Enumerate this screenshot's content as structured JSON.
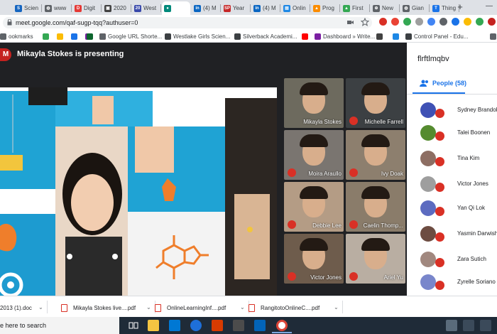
{
  "browser": {
    "tabs": [
      {
        "label": "Scien",
        "fav_color": "#1565c0",
        "fav_glyph": "S"
      },
      {
        "label": "www",
        "fav_color": "#5f6368",
        "fav_glyph": "◍"
      },
      {
        "label": "Digit",
        "fav_color": "#e53935",
        "fav_glyph": "D"
      },
      {
        "label": "2020",
        "fav_color": "#424242",
        "fav_glyph": "▣"
      },
      {
        "label": "West",
        "fav_color": "#3949ab",
        "fav_glyph": "20"
      },
      {
        "label": "",
        "fav_color": "#00897b",
        "fav_glyph": "●",
        "active": true
      },
      {
        "label": "(4) M",
        "fav_color": "#0a66c2",
        "fav_glyph": "in"
      },
      {
        "label": "Year",
        "fav_color": "#c62828",
        "fav_glyph": "SP"
      },
      {
        "label": "(4) M",
        "fav_color": "#0a66c2",
        "fav_glyph": "in"
      },
      {
        "label": "Onlin",
        "fav_color": "#1e88e5",
        "fav_glyph": "▤"
      },
      {
        "label": "Prog",
        "fav_color": "#fb8c00",
        "fav_glyph": "▲"
      },
      {
        "label": "First",
        "fav_color": "#34a853",
        "fav_glyph": "▲"
      },
      {
        "label": "New",
        "fav_color": "#5f6368",
        "fav_glyph": "⊕"
      },
      {
        "label": "Gian",
        "fav_color": "#5f6368",
        "fav_glyph": "◍"
      },
      {
        "label": "Thing",
        "fav_color": "#1a73e8",
        "fav_glyph": "T"
      }
    ],
    "new_tab_label": "+",
    "minimize_label": "—",
    "url": "meet.google.com/qaf-sugp-tqq?authuser=0",
    "bookmarks": [
      {
        "label": "ookmarks",
        "color": "#5f6368"
      },
      {
        "label": "",
        "color": "#34a853"
      },
      {
        "label": "",
        "color": "#fbbc04"
      },
      {
        "label": "",
        "color": "#1a73e8"
      },
      {
        "label": "",
        "color": "#7b1fa2"
      },
      {
        "label": "",
        "color": "#e53935"
      },
      {
        "label": "",
        "color": "#0d652d"
      },
      {
        "label": "Google URL Shorte...",
        "color": "#5f6368"
      },
      {
        "label": "Westlake Girls Scien...",
        "color": "#3c4043"
      },
      {
        "label": "Silverback Academi...",
        "color": "#3c4043"
      },
      {
        "label": "",
        "color": "#ff0000"
      },
      {
        "label": "Dashboard » Write...",
        "color": "#7b1fa2"
      },
      {
        "label": "",
        "color": "#424242"
      },
      {
        "label": "",
        "color": "#1e88e5"
      },
      {
        "label": "Control Panel - Edu...",
        "color": "#3c4043"
      },
      {
        "label": "",
        "color": "#5f6368"
      }
    ]
  },
  "meet": {
    "presenter_initial": "M",
    "presenting_text": "Mikayla Stokes is presenting",
    "tiles": [
      {
        "name": "Mikayla Stokes",
        "bg": "#6d6a5e",
        "mic_off": false
      },
      {
        "name": "Michelle Farrell",
        "bg": "#3c4043",
        "mic_off": true
      },
      {
        "name": "Moira Araullo",
        "bg": "#7a7570",
        "mic_off": true
      },
      {
        "name": "Ivy Doak",
        "bg": "#8d7f6e",
        "mic_off": true
      },
      {
        "name": "Debbie Lee",
        "bg": "#b49c85",
        "mic_off": true
      },
      {
        "name": "Caelin Thomp...",
        "bg": "#8a7c6a",
        "mic_off": true
      },
      {
        "name": "Victor Jones",
        "bg": "#6e5c4c",
        "mic_off": true
      },
      {
        "name": "Ariel Yu",
        "bg": "#b9aea2",
        "mic_off": true
      }
    ]
  },
  "panel": {
    "meeting_code": "flrftlmqbv",
    "people_tab_label": "People (58)",
    "people": [
      {
        "name": "Sydney Brandolino",
        "avatar_color": "#3f51b5"
      },
      {
        "name": "Talei Boonen",
        "avatar_color": "#558b2f"
      },
      {
        "name": "Tina Kim",
        "avatar_color": "#8d6e63"
      },
      {
        "name": "Victor Jones",
        "avatar_color": "#9e9e9e"
      },
      {
        "name": "Yan Qi Lok",
        "avatar_color": "#5c6bc0"
      },
      {
        "name": "Yasmin Darwish",
        "avatar_color": "#6d4c41"
      },
      {
        "name": "Zara Sutich",
        "avatar_color": "#a1887f"
      },
      {
        "name": "Zyrelle Soriano",
        "avatar_color": "#7986cb"
      }
    ]
  },
  "downloads": [
    {
      "label": "2013 (1).doc"
    },
    {
      "label": "Mikayla Stokes live....pdf"
    },
    {
      "label": "OnlineLearningInf....pdf"
    },
    {
      "label": "RangitotoOnlineC....pdf"
    }
  ],
  "taskbar": {
    "search_placeholder": "e here to search"
  }
}
